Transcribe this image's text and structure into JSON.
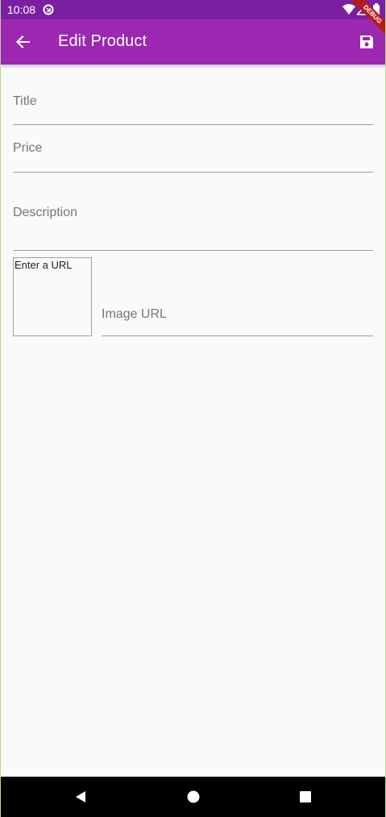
{
  "status_bar": {
    "time": "10:08"
  },
  "app_bar": {
    "title": "Edit Product",
    "debug_label": "DEBUG"
  },
  "form": {
    "title_label": "Title",
    "price_label": "Price",
    "description_label": "Description",
    "image_preview_text": "Enter a URL",
    "image_url_label": "Image URL"
  },
  "colors": {
    "status_bar": "#7b1fa2",
    "app_bar": "#9c27b0",
    "background": "#fafafa",
    "nav_bar": "#000000"
  },
  "icons": {
    "back": "arrow-back-icon",
    "save": "save-icon",
    "nav_back": "nav-back-triangle-icon",
    "nav_home": "nav-home-circle-icon",
    "nav_recents": "nav-recents-square-icon"
  }
}
